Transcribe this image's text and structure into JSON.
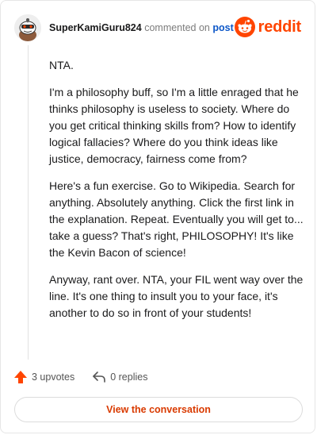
{
  "header": {
    "username": "SuperKamiGuru824",
    "action_text": "commented on",
    "post_link": "post",
    "brand": "reddit"
  },
  "comment": {
    "paragraphs": [
      "NTA.",
      "I'm a philosophy buff, so I'm a little enraged that he thinks philosophy is useless to society. Where do you get critical thinking skills from? How to identify logical fallacies? Where do you think ideas like justice, democracy, fairness come from?",
      "Here's a fun exercise. Go to Wikipedia. Search for anything. Absolutely anything. Click the first link in the explanation. Repeat. Eventually you will get to... take a guess? That's right, PHILOSOPHY! It's like the Kevin Bacon of science!",
      "Anyway, rant over. NTA, your FIL went way over the line. It's one thing to insult you to your face, it's another to do so in front of your students!"
    ]
  },
  "actions": {
    "upvotes": "3 upvotes",
    "replies": "0 replies"
  },
  "cta": {
    "label": "View the conversation"
  },
  "icons": {
    "avatar": "snoo-avatar-icon",
    "brand": "reddit-logo-icon",
    "upvote": "upvote-arrow-icon",
    "reply": "reply-arrow-icon"
  },
  "colors": {
    "brand": "#ff4500",
    "link": "#0e58c8",
    "cta": "#d93a00"
  }
}
